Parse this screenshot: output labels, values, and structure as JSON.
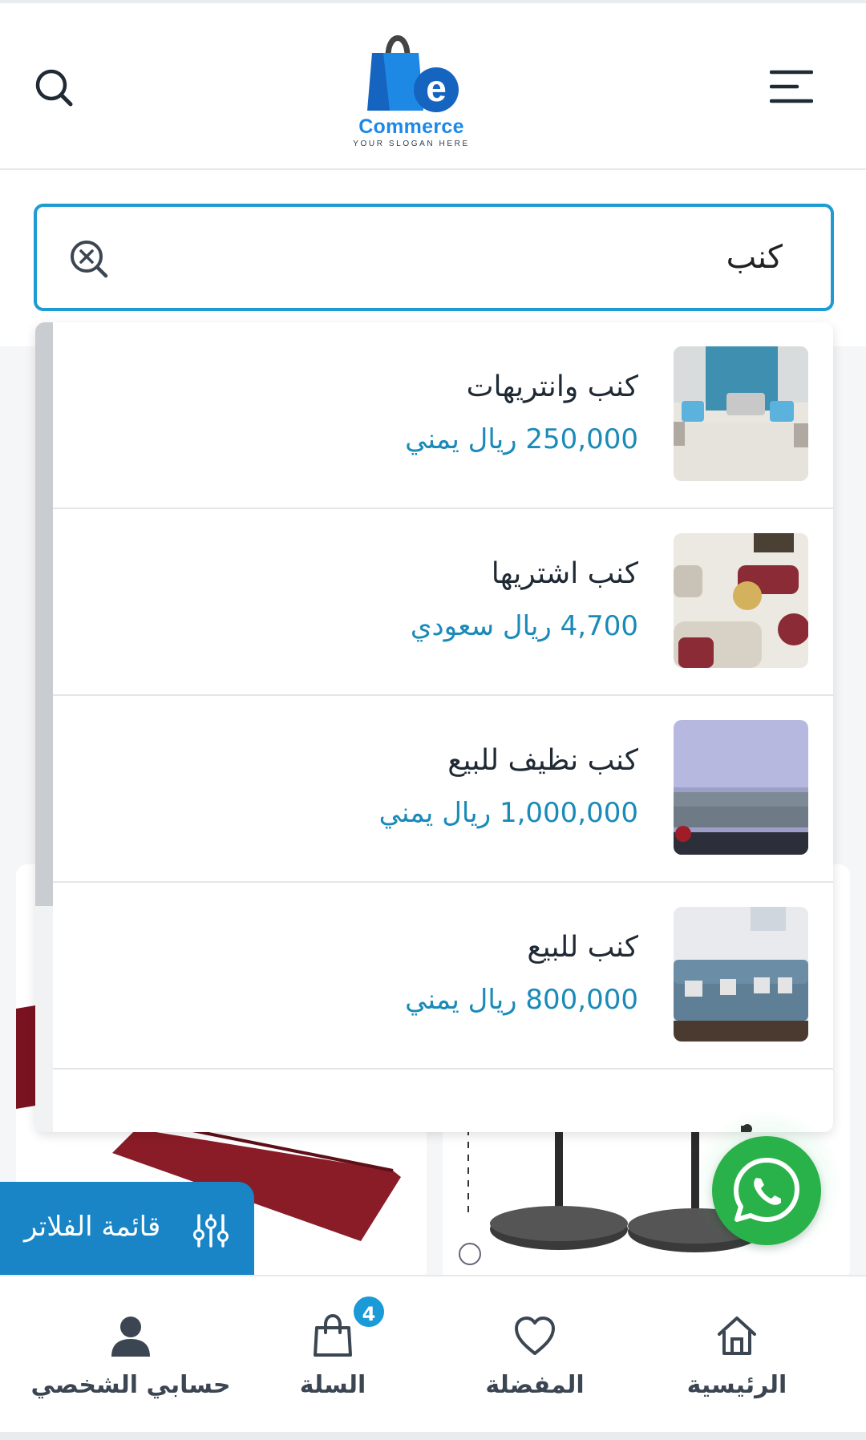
{
  "header": {
    "logo_text": "Commerce",
    "logo_slogan": "YOUR SLOGAN HERE",
    "logo_letter": "e"
  },
  "search": {
    "value": "كنب",
    "placeholder": ""
  },
  "results": [
    {
      "title": "كنب وانتريهات",
      "price": "250,000 ريال يمني"
    },
    {
      "title": "كنب اشتريها",
      "price": "4,700 ريال سعودي"
    },
    {
      "title": "كنب نظيف للبيع",
      "price": "1,000,000 ريال يمني"
    },
    {
      "title": "كنب للبيع",
      "price": "800,000 ريال يمني"
    }
  ],
  "filter": {
    "label": "قائمة الفلاتر"
  },
  "nav": {
    "home": "الرئيسية",
    "favorites": "المفضلة",
    "cart": "السلة",
    "cart_count": "4",
    "account": "حسابي الشخصي"
  },
  "colors": {
    "accent": "#1d9cd3",
    "price": "#1a8ab8",
    "filter": "#1985c6",
    "whatsapp": "#29b24a"
  }
}
